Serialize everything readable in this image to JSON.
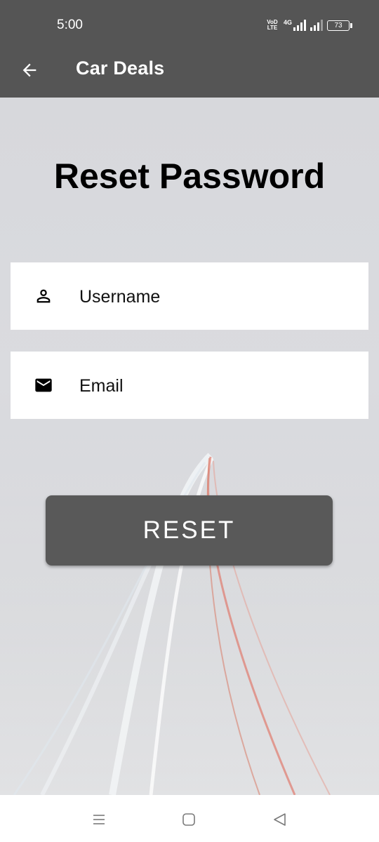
{
  "status_bar": {
    "time": "5:00",
    "volte_label": "VoLTE",
    "network_label": "4G",
    "battery": "73"
  },
  "app_bar": {
    "title": "Car Deals",
    "back_icon": "arrow-back-icon"
  },
  "page": {
    "title": "Reset Password"
  },
  "form": {
    "username": {
      "placeholder": "Username",
      "value": "",
      "icon": "person-icon"
    },
    "email": {
      "placeholder": "Email",
      "value": "",
      "icon": "mail-icon"
    },
    "reset_label": "RESET"
  },
  "nav_bar": {
    "menu_icon": "menu-icon",
    "home_icon": "home-square-icon",
    "back_icon": "back-triangle-icon"
  },
  "colors": {
    "app_bar": "#555555",
    "button": "#595959",
    "background": "#d6d7db",
    "field": "#ffffff"
  }
}
